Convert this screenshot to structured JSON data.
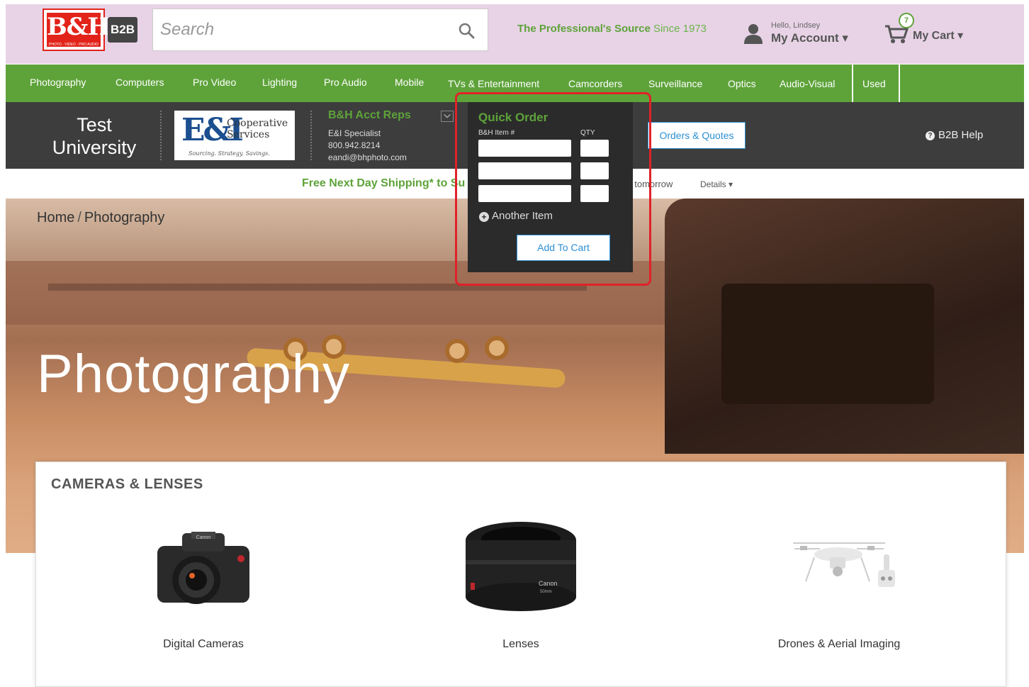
{
  "header": {
    "logo_text": "B&H",
    "logo_tagline": "PHOTO · VIDEO · PRO AUDIO",
    "b2b_label": "B2B",
    "search_placeholder": "Search",
    "tagline_bold": "The Professional's Source",
    "tagline_since": "Since 1973",
    "account_hello": "Hello, Lindsey",
    "account_label": "My Account ▾",
    "cart_count": "7",
    "cart_label": "My Cart ▾"
  },
  "categories": [
    "Photography",
    "Computers",
    "Pro Video",
    "Lighting",
    "Pro Audio",
    "Mobile",
    "TVs & Entertainment",
    "Camcorders",
    "Surveillance",
    "Optics",
    "Audio-Visual",
    "Used"
  ],
  "b2b": {
    "university": "Test University",
    "ei_logo": "E&I",
    "ei_name": "Cooperative Services",
    "ei_tagline": "Sourcing. Strategy. Savings.",
    "reps_title": "B&H Acct Reps",
    "reps_role": "E&I Specialist",
    "reps_phone": "800.942.8214",
    "reps_email": "eandi@bhphoto.com",
    "orders_label": "Orders & Quotes",
    "help_label": "B2B Help"
  },
  "shipping": {
    "text": "Free Next Day Shipping* to Su",
    "tail": "t tomorrow",
    "details": "Details ▾"
  },
  "hero": {
    "breadcrumb_home": "Home",
    "breadcrumb_sep": "/",
    "breadcrumb_current": "Photography",
    "title": "Photography"
  },
  "quick_order": {
    "title": "Quick Order",
    "item_label": "B&H Item #",
    "qty_label": "QTY",
    "another": "Another Item",
    "add_to_cart": "Add To Cart"
  },
  "cameras": {
    "title": "CAMERAS & LENSES",
    "products": [
      {
        "label": "Digital Cameras",
        "icon": "camera-image"
      },
      {
        "label": "Lenses",
        "icon": "lens-image"
      },
      {
        "label": "Drones & Aerial Imaging",
        "icon": "drone-image"
      }
    ]
  },
  "colors": {
    "brand_green": "#5ea33a",
    "header_bg": "#e8d3e6",
    "dark_bar": "#3d3d3d",
    "highlight_red": "#e0222a",
    "link_blue": "#2d8fd5"
  }
}
